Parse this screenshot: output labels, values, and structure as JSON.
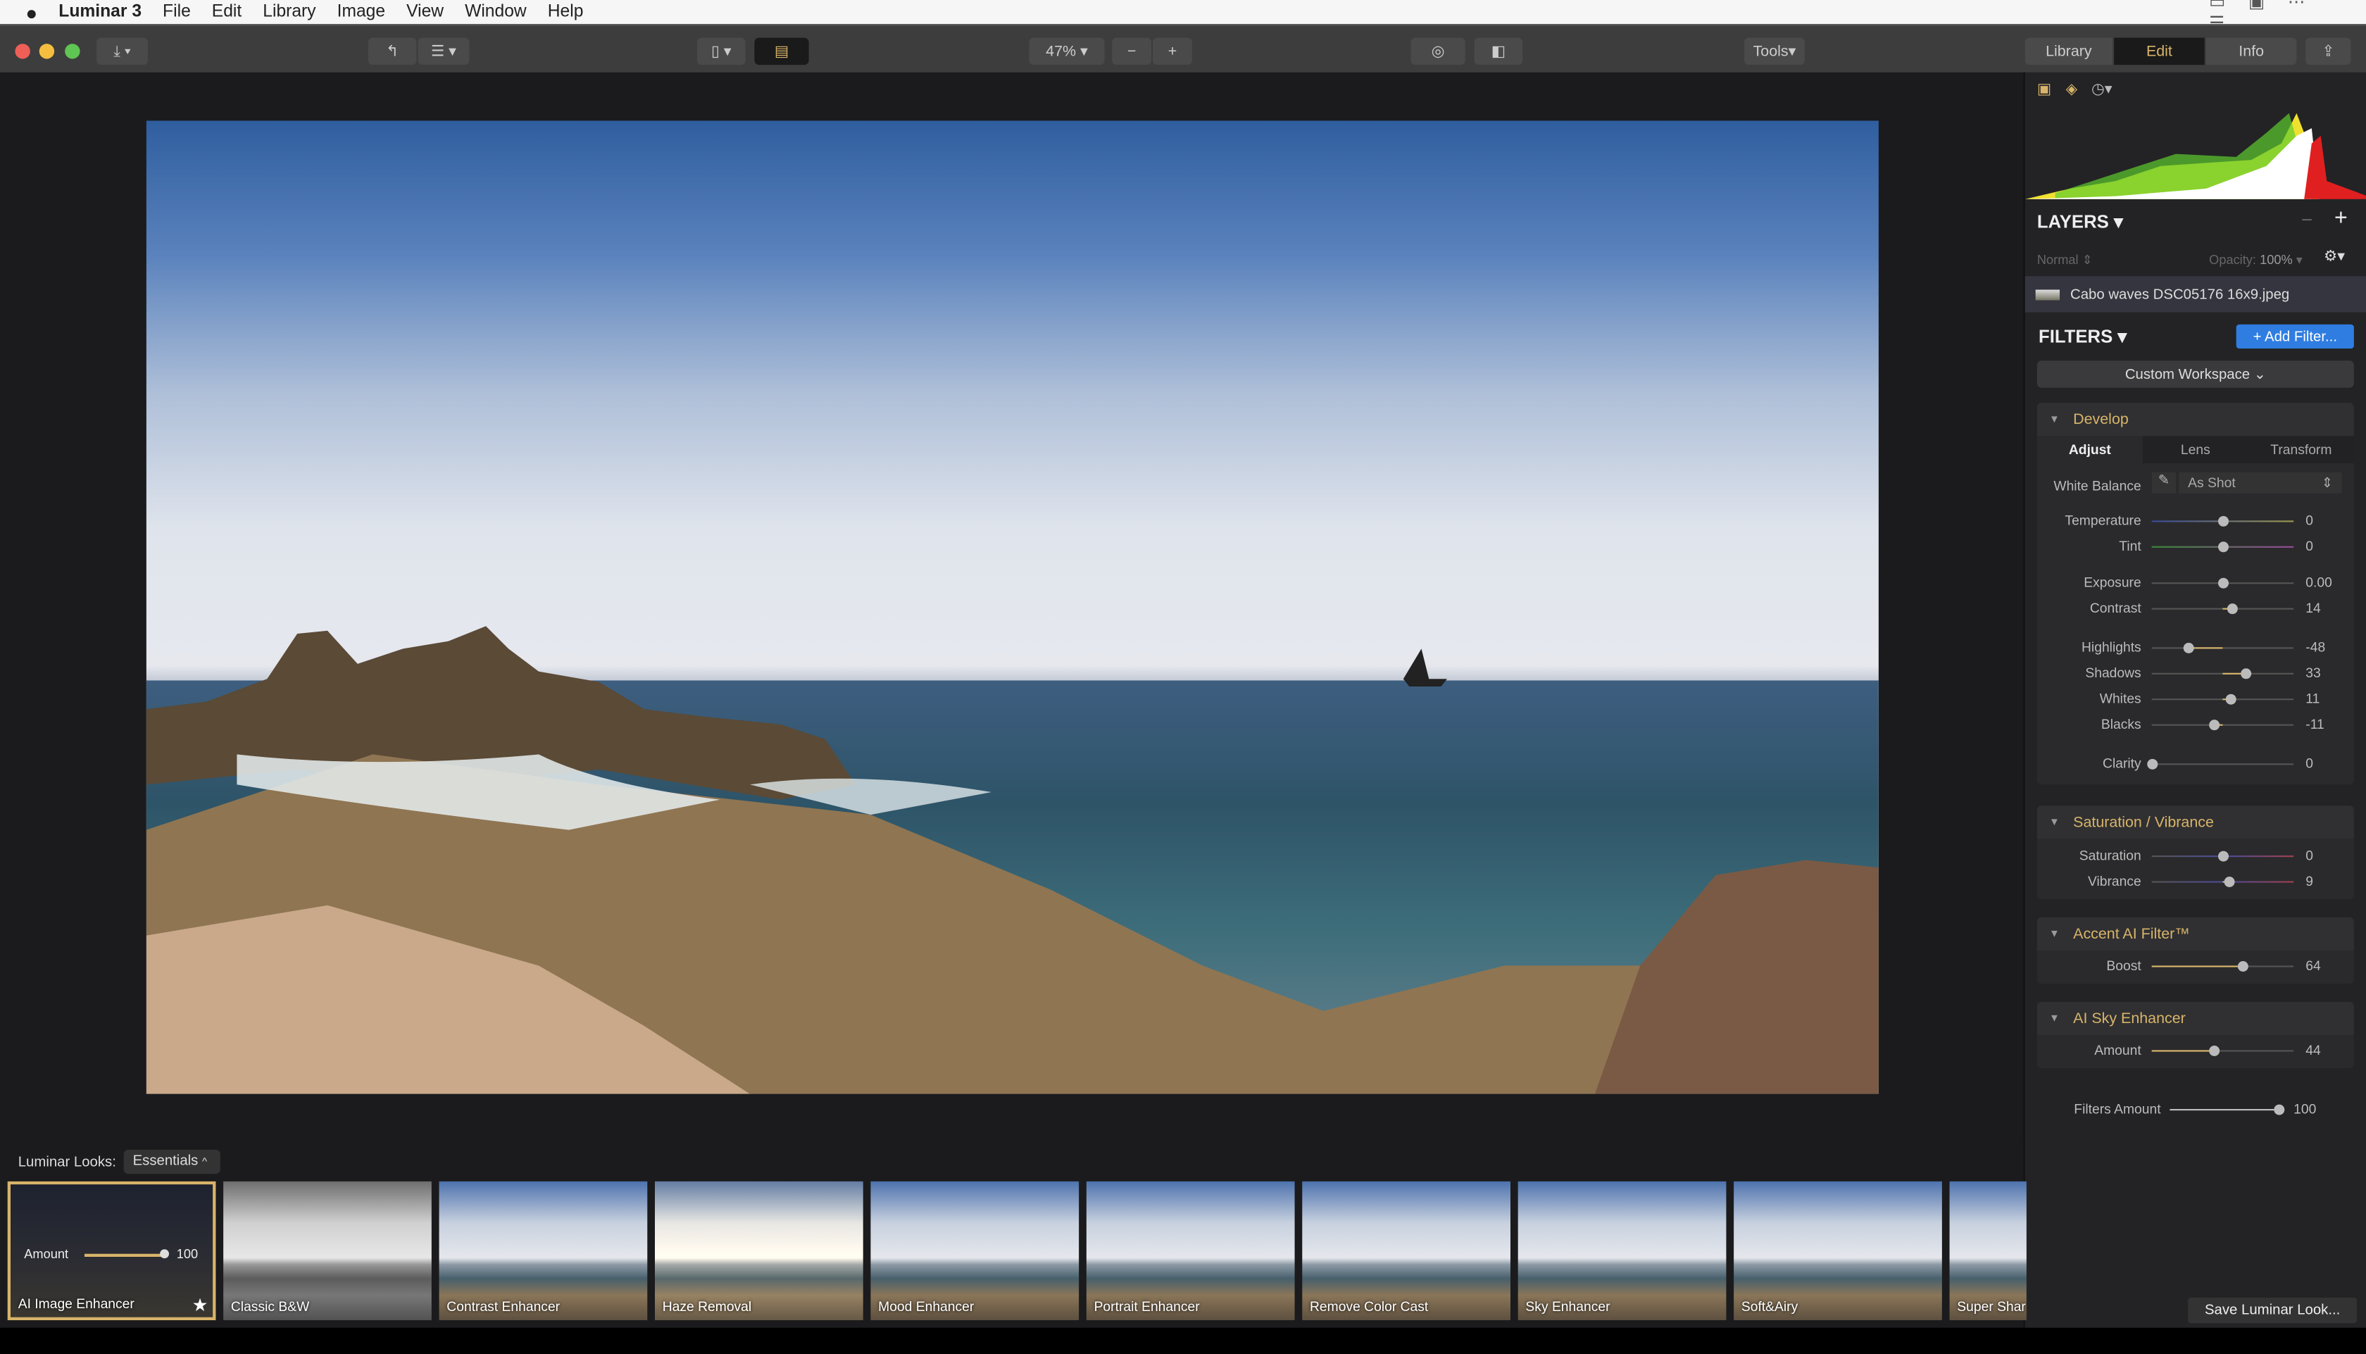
{
  "menubar": {
    "app": "Luminar 3",
    "items": [
      "File",
      "Edit",
      "Library",
      "Image",
      "View",
      "Window",
      "Help"
    ]
  },
  "toolbar": {
    "zoom": "47%",
    "zoom_out": "−",
    "zoom_in": "+",
    "tools": "Tools",
    "tabs": [
      "Library",
      "Edit",
      "Info"
    ],
    "active_tab": "Edit"
  },
  "colors": {
    "accent": "#d8b46a",
    "button_blue": "#2f7de1"
  },
  "layers": {
    "title": "LAYERS",
    "blend": "Normal",
    "opacity_label": "Opacity:",
    "opacity": "100%",
    "layer_name": "Cabo waves DSC05176 16x9.jpeg"
  },
  "filters": {
    "title": "FILTERS",
    "add": "+ Add Filter...",
    "workspace": "Custom Workspace"
  },
  "develop": {
    "title": "Develop",
    "tabs": [
      "Adjust",
      "Lens",
      "Transform"
    ],
    "wb_label": "White Balance",
    "wb_value": "As Shot",
    "sliders": [
      {
        "label": "Temperature",
        "value": "0",
        "num": 0,
        "min": -100,
        "max": 100
      },
      {
        "label": "Tint",
        "value": "0",
        "num": 0,
        "min": -100,
        "max": 100
      },
      {
        "label": "Exposure",
        "value": "0.00",
        "num": 0,
        "min": -4,
        "max": 4
      },
      {
        "label": "Contrast",
        "value": "14",
        "num": 14,
        "min": -100,
        "max": 100
      },
      {
        "label": "Highlights",
        "value": "-48",
        "num": -48,
        "min": -100,
        "max": 100
      },
      {
        "label": "Shadows",
        "value": "33",
        "num": 33,
        "min": -100,
        "max": 100
      },
      {
        "label": "Whites",
        "value": "11",
        "num": 11,
        "min": -100,
        "max": 100
      },
      {
        "label": "Blacks",
        "value": "-11",
        "num": -11,
        "min": -100,
        "max": 100
      },
      {
        "label": "Clarity",
        "value": "0",
        "num": 0,
        "min": 0,
        "max": 100
      }
    ]
  },
  "satvib": {
    "title": "Saturation / Vibrance",
    "sliders": [
      {
        "label": "Saturation",
        "value": "0",
        "num": 0,
        "min": -100,
        "max": 100
      },
      {
        "label": "Vibrance",
        "value": "9",
        "num": 9,
        "min": -100,
        "max": 100
      }
    ]
  },
  "accent": {
    "title": "Accent AI Filter™",
    "sliders": [
      {
        "label": "Boost",
        "value": "64",
        "num": 64,
        "min": 0,
        "max": 100
      }
    ]
  },
  "sky": {
    "title": "AI Sky Enhancer",
    "sliders": [
      {
        "label": "Amount",
        "value": "44",
        "num": 44,
        "min": 0,
        "max": 100
      }
    ]
  },
  "filters_amount": {
    "label": "Filters Amount",
    "value": "100",
    "num": 100,
    "min": 0,
    "max": 100
  },
  "looks": {
    "label": "Luminar Looks:",
    "category": "Essentials",
    "amount_label": "Amount",
    "amount": "100",
    "items": [
      "AI Image Enhancer",
      "Classic B&W",
      "Contrast Enhancer",
      "Haze Removal",
      "Mood Enhancer",
      "Portrait Enhancer",
      "Remove Color Cast",
      "Sky Enhancer",
      "Soft&Airy",
      "Super Shar"
    ],
    "save": "Save Luminar Look..."
  }
}
